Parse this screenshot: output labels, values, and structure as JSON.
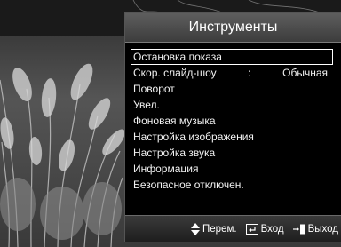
{
  "menu": {
    "title": "Инструменты",
    "items": [
      {
        "label": "Остановка показа"
      },
      {
        "label": "Скор. слайд-шоу",
        "separator": ":",
        "value": "Обычная"
      },
      {
        "label": "Поворот"
      },
      {
        "label": "Увел."
      },
      {
        "label": "Фоновая музыка"
      },
      {
        "label": "Настройка изображения"
      },
      {
        "label": "Настройка звука"
      },
      {
        "label": "Информация"
      },
      {
        "label": "Безопасное отключен."
      }
    ],
    "selected_index": 0
  },
  "footer": {
    "move_label": "Перем.",
    "move_icon": "up-down-arrows-icon",
    "enter_label": "Вход",
    "enter_icon": "enter-icon",
    "exit_label": "Выход",
    "exit_icon": "exit-icon"
  },
  "colors": {
    "menu_bg": "#000000",
    "title_bar": "#4a4a4a",
    "text": "#f2f2f2",
    "selection_border": "#ffffff"
  }
}
